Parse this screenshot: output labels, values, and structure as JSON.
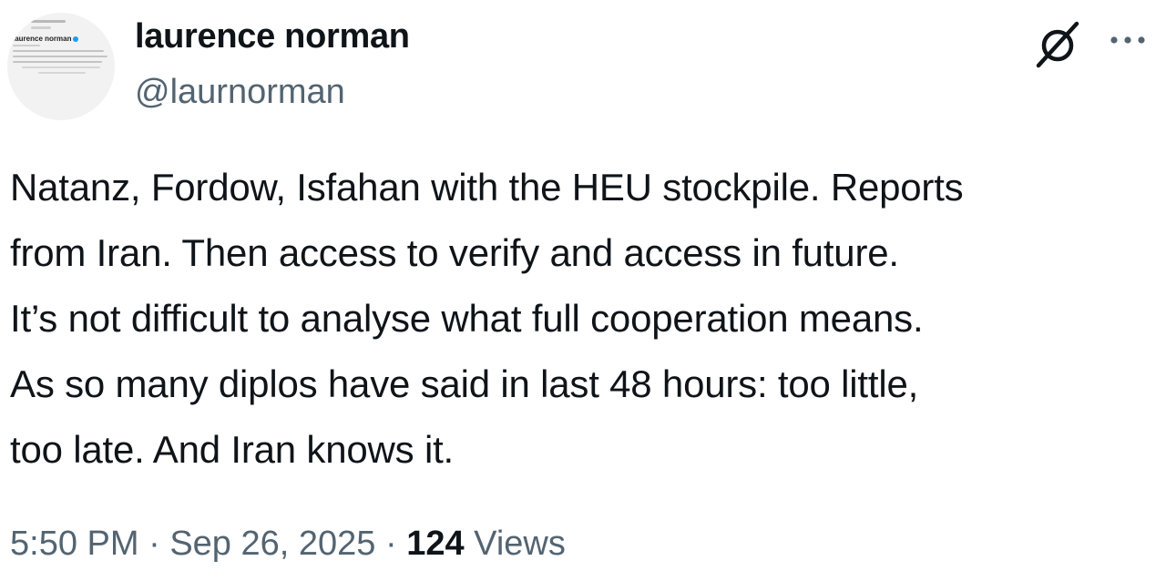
{
  "author": {
    "display_name": "laurence norman",
    "handle": "@laurnorman"
  },
  "avatar": {
    "thumb_name": "laurence norman"
  },
  "icons": {
    "grok": "grok-icon",
    "more": "more-dots-icon"
  },
  "tweet": {
    "text": "Natanz, Fordow, Isfahan with the HEU stockpile. Reports\nfrom Iran. Then access to verify and access in future.\nIt’s not difficult to analyse what full cooperation means.\nAs so many diplos have said in last 48 hours: too little,\ntoo late. And Iran knows it."
  },
  "meta": {
    "time": "5:50 PM",
    "separator": " · ",
    "date": "Sep 26, 2025",
    "views_count": "124",
    "views_label": "Views"
  },
  "colors": {
    "text_primary": "#0f1419",
    "text_secondary": "#536471",
    "verified_blue": "#1d9bf0"
  }
}
